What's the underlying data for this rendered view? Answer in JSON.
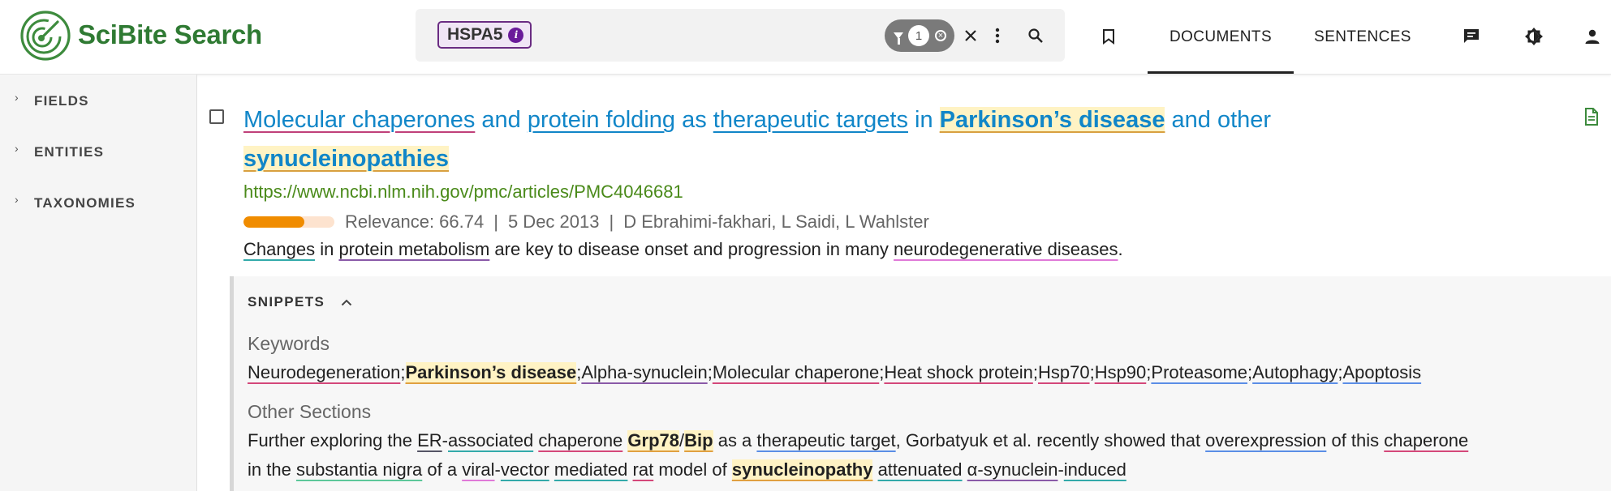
{
  "app": {
    "name": "SciBite Search",
    "brand_color": "#2f7a33"
  },
  "search": {
    "chip_label": "HSPA5",
    "chip_info": "i",
    "filter_count": "1"
  },
  "header": {
    "tabs": [
      {
        "label": "DOCUMENTS",
        "active": true
      },
      {
        "label": "SENTENCES",
        "active": false
      }
    ],
    "icons": [
      "bookmark-icon",
      "chat-icon",
      "theme-toggle-icon",
      "account-icon"
    ]
  },
  "sidebar": {
    "items": [
      {
        "label": "FIELDS"
      },
      {
        "label": "ENTITIES"
      },
      {
        "label": "TAXONOMIES"
      }
    ]
  },
  "result": {
    "title_parts": [
      "Molecular chaperones",
      " and ",
      "protein folding",
      " as ",
      "therapeutic targets",
      " in ",
      "Parkinson’s disease",
      " and other",
      "synucleinopathies"
    ],
    "url": "https://www.ncbi.nlm.nih.gov/pmc/articles/PMC4046681",
    "relevance_label": "Relevance: 66.74",
    "relevance_fraction": 0.67,
    "date": "5 Dec 2013",
    "authors": "D Ebrahimi-fakhari, L Saidi, L Wahlster",
    "separator": "|",
    "abstract_parts": [
      "Changes",
      " in ",
      "protein metabolism",
      " are key to disease onset and progression in many ",
      "neurodegenerative diseases",
      "."
    ]
  },
  "snippets": {
    "heading": "SNIPPETS",
    "keywords_label": "Keywords",
    "keywords": [
      "Neurodegeneration",
      ";",
      "Parkinson’s disease",
      ";",
      "Alpha-synuclein",
      ";",
      "Molecular chaperone",
      ";",
      "Heat shock protein",
      ";",
      "Hsp70",
      ";",
      "Hsp90",
      ";",
      "Proteasome",
      ";",
      "Autophagy",
      ";",
      "Apoptosis"
    ],
    "other_label": "Other Sections",
    "line1": [
      "Further exploring the ",
      "ER",
      "-",
      "associated",
      " ",
      "chaperone",
      " ",
      "Grp78",
      "/",
      "Bip",
      " as a ",
      "therapeutic target",
      ", Gorbatyuk et al. recently showed that ",
      "overexpression",
      " of this ",
      "chaperone"
    ],
    "line2": [
      "in the ",
      "substantia nigra",
      " of a ",
      "viral",
      "-",
      "vector",
      " ",
      "mediated",
      " ",
      "rat",
      " model of ",
      "synucleinopathy",
      " ",
      "attenuated",
      " ",
      "α-synuclein",
      "-",
      "induced"
    ]
  }
}
